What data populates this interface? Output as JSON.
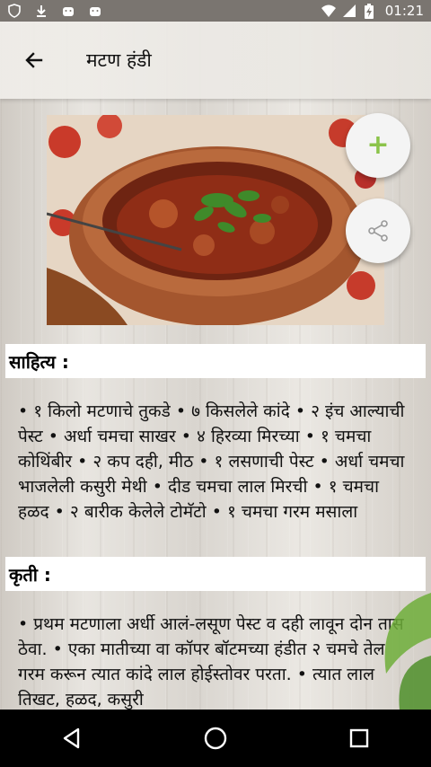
{
  "status_bar": {
    "time": "01:21",
    "icons": [
      "shield-icon",
      "download-icon",
      "android-icon",
      "android-icon",
      "wifi-icon",
      "signal-icon",
      "battery-charging-icon"
    ]
  },
  "app_bar": {
    "title": "मटण हंडी",
    "back_icon": "arrow-left-icon"
  },
  "fabs": {
    "add_icon": "plus-icon",
    "share_icon": "share-icon",
    "add_color": "#8bc34a"
  },
  "ingredients": {
    "heading": "साहित्य :",
    "text": "• १ किलो मटणाचे तुकडे • ७ किसलेले कांदे • २ इंच आल्याची पेस्ट • अर्धा चमचा साखर • ४ हिरव्या मिरच्या • १ चमचा कोथिंबीर • २ कप दही, मीठ • १ लसणाची पेस्ट • अर्धा चमचा भाजलेली कसुरी मेथी • दीड चमचा लाल मिरची • १ चमचा हळद • २ बारीक केलेले टोमॅटो • १ चमचा गरम मसाला"
  },
  "method": {
    "heading": "कृती :",
    "text": "• प्रथम मटणाला अर्धी आलं-लसूण पेस्ट व दही लावून दोन तास ठेवा. • एका मातीच्या वा कॉपर बॉटमच्या हंडीत २ चमचे तेल गरम करून त्यात कांदे लाल होईस्तोवर परता. • त्यात लाल तिखट, हळद, कसुरी"
  },
  "nav_bar": {
    "back": "triangle-back-icon",
    "home": "circle-home-icon",
    "recents": "square-recents-icon"
  }
}
